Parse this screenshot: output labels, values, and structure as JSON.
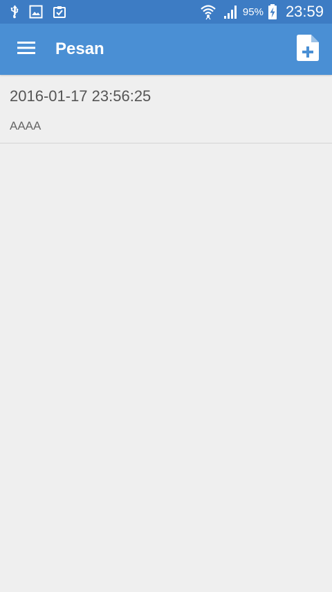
{
  "status_bar": {
    "battery_percent": "95%",
    "time": "23:59",
    "left_icons": [
      "usb-icon",
      "gallery-icon",
      "clipboard-check-icon"
    ],
    "right_icons": [
      "wifi-icon",
      "signal-icon",
      "battery-charging-icon"
    ]
  },
  "app_bar": {
    "title": "Pesan",
    "menu_icon": "hamburger-menu-icon",
    "action_icon": "new-document-icon"
  },
  "messages": [
    {
      "timestamp": "2016-01-17 23:56:25",
      "text": "AAAA"
    }
  ],
  "colors": {
    "status_bar": "#3d7cc4",
    "app_bar": "#4a8fd4",
    "background": "#efefef",
    "divider": "#d4d4d4",
    "text_primary": "#555555",
    "text_secondary": "#666666"
  }
}
